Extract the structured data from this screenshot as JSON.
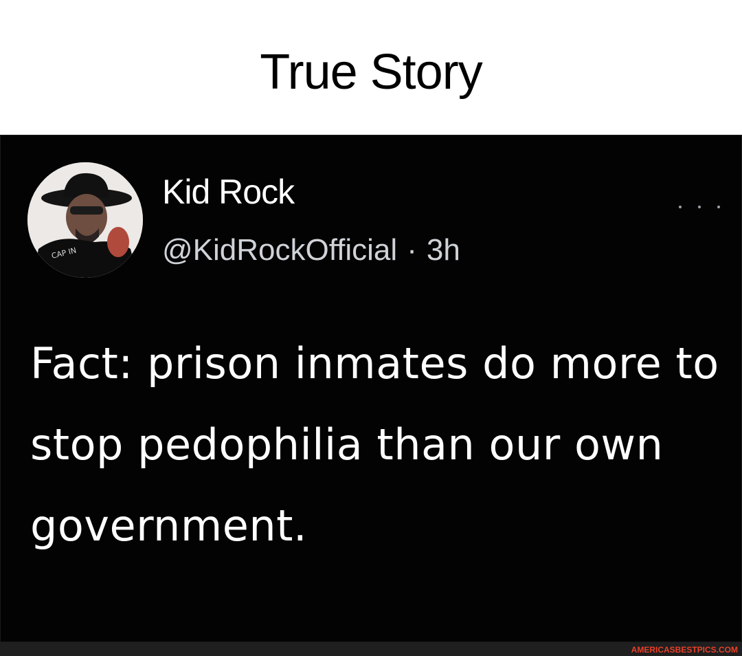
{
  "meme": {
    "title": "True Story"
  },
  "tweet": {
    "display_name": "Kid Rock",
    "handle": "@KidRockOfficial",
    "separator": "·",
    "time": "3h",
    "text": "Fact: prison inmates do more to stop pedophilia than our own government.",
    "more_icon": "more-horizontal-icon",
    "avatar_icon": "profile-avatar"
  },
  "footer": {
    "watermark": "AMERICASBESTPICS.COM"
  },
  "colors": {
    "card_background": "#030303",
    "handle_text": "#cfd3d8",
    "watermark_text": "#e8402a"
  }
}
